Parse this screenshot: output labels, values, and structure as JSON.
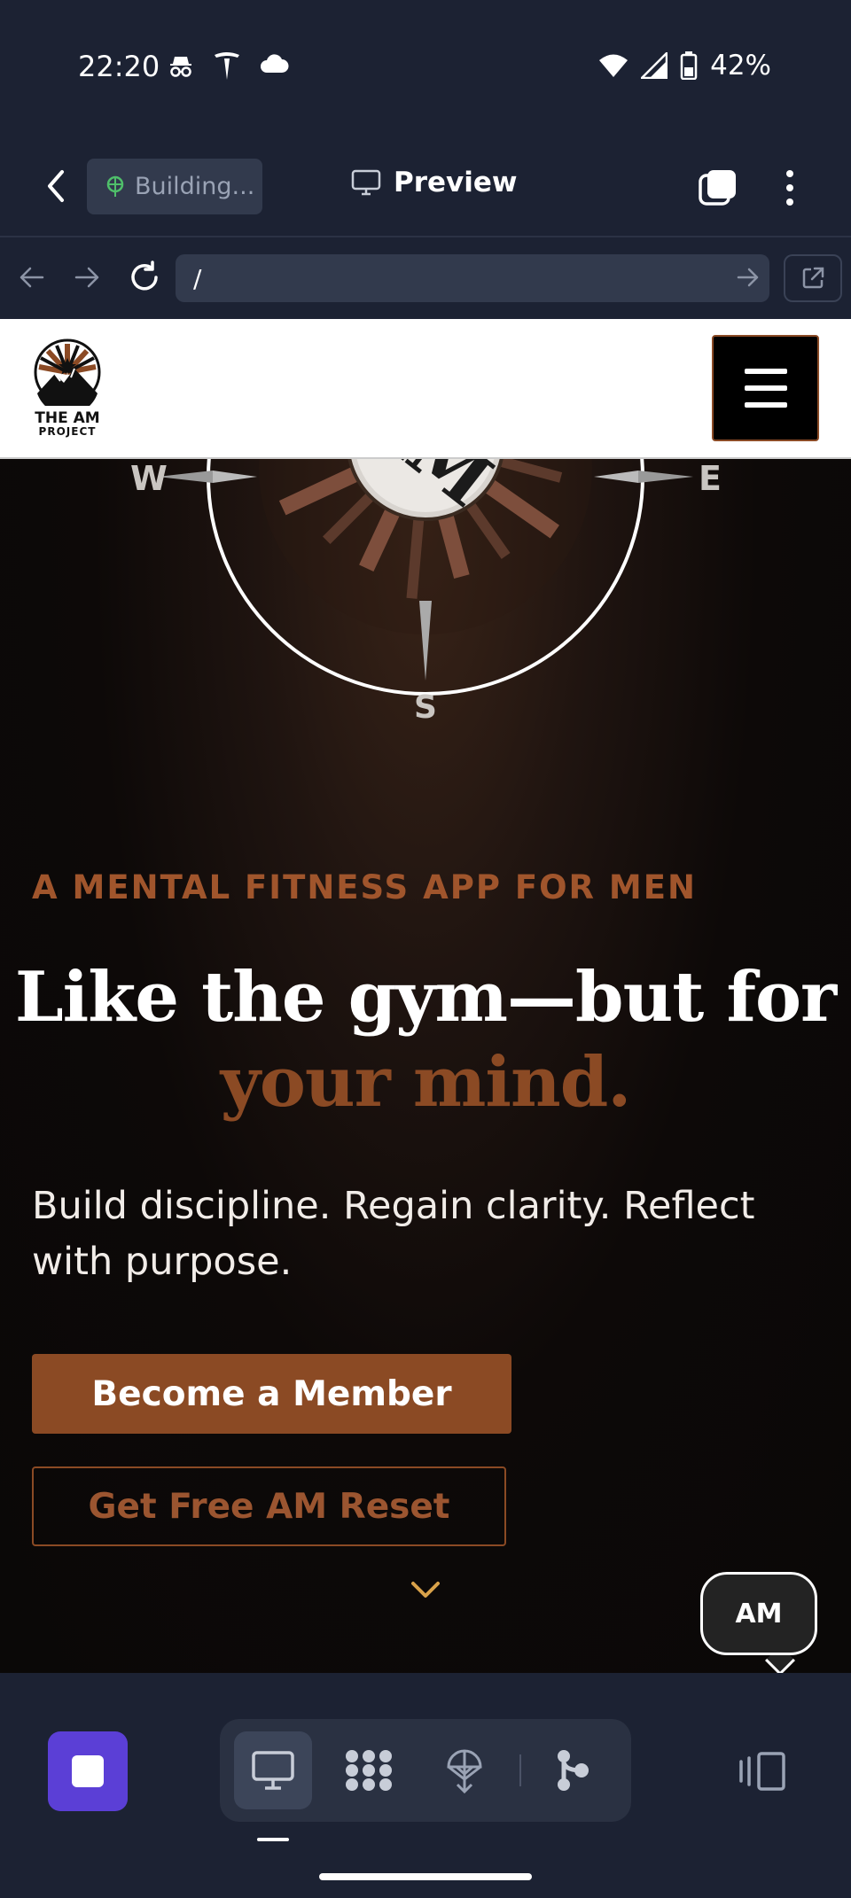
{
  "status_bar": {
    "time": "22:20",
    "battery": "42%",
    "left_icons": [
      "incognito-icon",
      "tesla-icon",
      "cloud-icon"
    ],
    "right_icons": [
      "wifi-icon",
      "signal-icon",
      "battery-icon"
    ]
  },
  "toolbar": {
    "building_label": "Building...",
    "preview_label": "Preview"
  },
  "urlbar": {
    "url": "/"
  },
  "site": {
    "logo_line1": "THE AM",
    "logo_line2": "PROJECT",
    "compass": {
      "center_text": "AM",
      "west": "W",
      "east": "E",
      "south": "S"
    },
    "eyebrow": "A MENTAL FITNESS APP FOR MEN",
    "headline_line1": "Like the gym—but for",
    "headline_line2": "your mind.",
    "subhead": "Build discipline. Regain clarity. Reflect with purpose.",
    "primary_cta": "Become a Member",
    "secondary_cta": "Get Free AM Reset",
    "chat_bubble": "AM"
  },
  "colors": {
    "accent": "#8b4a24",
    "dock_stop": "#5b3fd6",
    "chrome": "#1c2233"
  },
  "dock": {
    "tools": [
      "desktop-preview-icon",
      "grid-dots-icon",
      "deploy-icon",
      "git-branch-icon"
    ],
    "active_tool": "desktop-preview-icon"
  }
}
